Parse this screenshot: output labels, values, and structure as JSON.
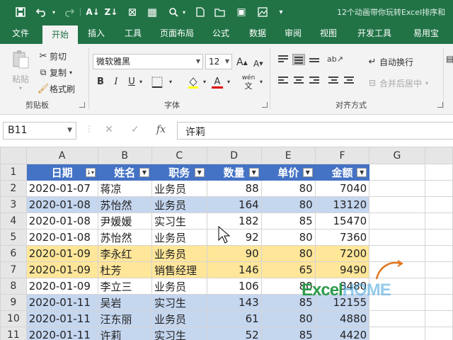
{
  "colors": {
    "brand": "#217346",
    "header_fill": "#4472c4",
    "band_blue": "#c5d6ef",
    "band_yellow": "#ffe699"
  },
  "title_bar": {
    "title": "12个动画带你玩转Excel排序和"
  },
  "quick_access": [
    "save-icon",
    "undo-icon",
    "redo-icon",
    "sort-asc-icon",
    "sort-desc-icon",
    "clear-icon",
    "borders-icon",
    "find-icon",
    "new-icon",
    "open-icon",
    "picture-icon",
    "more-icon"
  ],
  "tabs": [
    {
      "label": "文件"
    },
    {
      "label": "开始"
    },
    {
      "label": "插入"
    },
    {
      "label": "工具"
    },
    {
      "label": "页面布局"
    },
    {
      "label": "公式"
    },
    {
      "label": "数据"
    },
    {
      "label": "审阅"
    },
    {
      "label": "视图"
    },
    {
      "label": "开发工具"
    },
    {
      "label": "易用宝"
    }
  ],
  "ribbon": {
    "clipboard": {
      "paste": "粘贴",
      "cut": "剪切",
      "copy": "复制",
      "format_painter": "格式刷",
      "label": "剪贴板"
    },
    "font": {
      "name": "微软雅黑",
      "size": "12",
      "grow": "A",
      "shrink": "A",
      "bold": "B",
      "italic": "I",
      "underline": "U",
      "font_color": "A",
      "phonetic": "wén",
      "label": "字体"
    },
    "alignment": {
      "wrap_text": "自动换行",
      "merge_center": "合并后居中",
      "label": "对齐方式"
    }
  },
  "formula_bar": {
    "name_box": "B11",
    "fx": "fx",
    "value": "许莉"
  },
  "sheet": {
    "columns": [
      "A",
      "B",
      "C",
      "D",
      "E",
      "F",
      "G"
    ],
    "headers": [
      "日期",
      "姓名",
      "职务",
      "数量",
      "单价",
      "金额"
    ],
    "rows": [
      {
        "n": "2",
        "band": "white",
        "cells": [
          "2020-01-07",
          "蒋凉",
          "业务员",
          "88",
          "80",
          "7040"
        ]
      },
      {
        "n": "3",
        "band": "blue",
        "cells": [
          "2020-01-08",
          "苏怡然",
          "业务员",
          "164",
          "80",
          "13120"
        ]
      },
      {
        "n": "4",
        "band": "white",
        "cells": [
          "2020-01-08",
          "尹媛媛",
          "实习生",
          "182",
          "85",
          "15470"
        ]
      },
      {
        "n": "5",
        "band": "white",
        "cells": [
          "2020-01-08",
          "苏怡然",
          "业务员",
          "92",
          "80",
          "7360"
        ]
      },
      {
        "n": "6",
        "band": "yellow",
        "cells": [
          "2020-01-09",
          "李永红",
          "业务员",
          "90",
          "80",
          "7200"
        ]
      },
      {
        "n": "7",
        "band": "yellow",
        "cells": [
          "2020-01-09",
          "杜芳",
          "销售经理",
          "146",
          "65",
          "9490"
        ]
      },
      {
        "n": "8",
        "band": "white",
        "cells": [
          "2020-01-09",
          "李立三",
          "业务员",
          "106",
          "80",
          "8480"
        ]
      },
      {
        "n": "9",
        "band": "blue",
        "cells": [
          "2020-01-11",
          "吴岩",
          "实习生",
          "143",
          "85",
          "12155"
        ]
      },
      {
        "n": "10",
        "band": "blue",
        "cells": [
          "2020-01-11",
          "汪东丽",
          "业务员",
          "61",
          "80",
          "4880"
        ]
      },
      {
        "n": "11",
        "band": "blue",
        "cells": [
          "2020-01-11",
          "许莉",
          "实习生",
          "52",
          "85",
          "4420"
        ]
      }
    ],
    "header_row_num": "1"
  },
  "watermark": {
    "part1": "Excel",
    "part2": "HOME"
  }
}
